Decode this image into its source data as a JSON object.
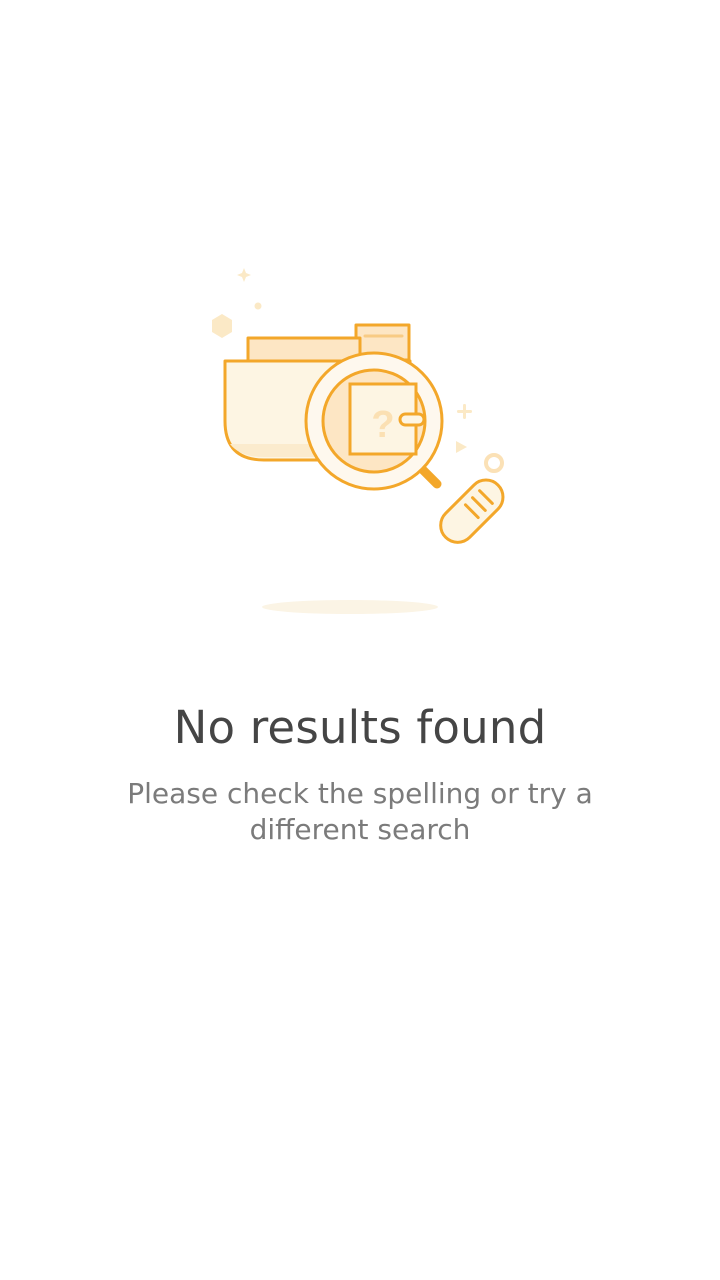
{
  "empty_state": {
    "illustration_icon": "folder-search-icon",
    "title": "No results found",
    "message": "Please check the spelling or try a different search"
  },
  "colors": {
    "accent": "#f3a72a",
    "accent_light": "#fdf3e2",
    "title_text": "#454545",
    "message_text": "#7b7b7b",
    "background": "#ffffff"
  }
}
